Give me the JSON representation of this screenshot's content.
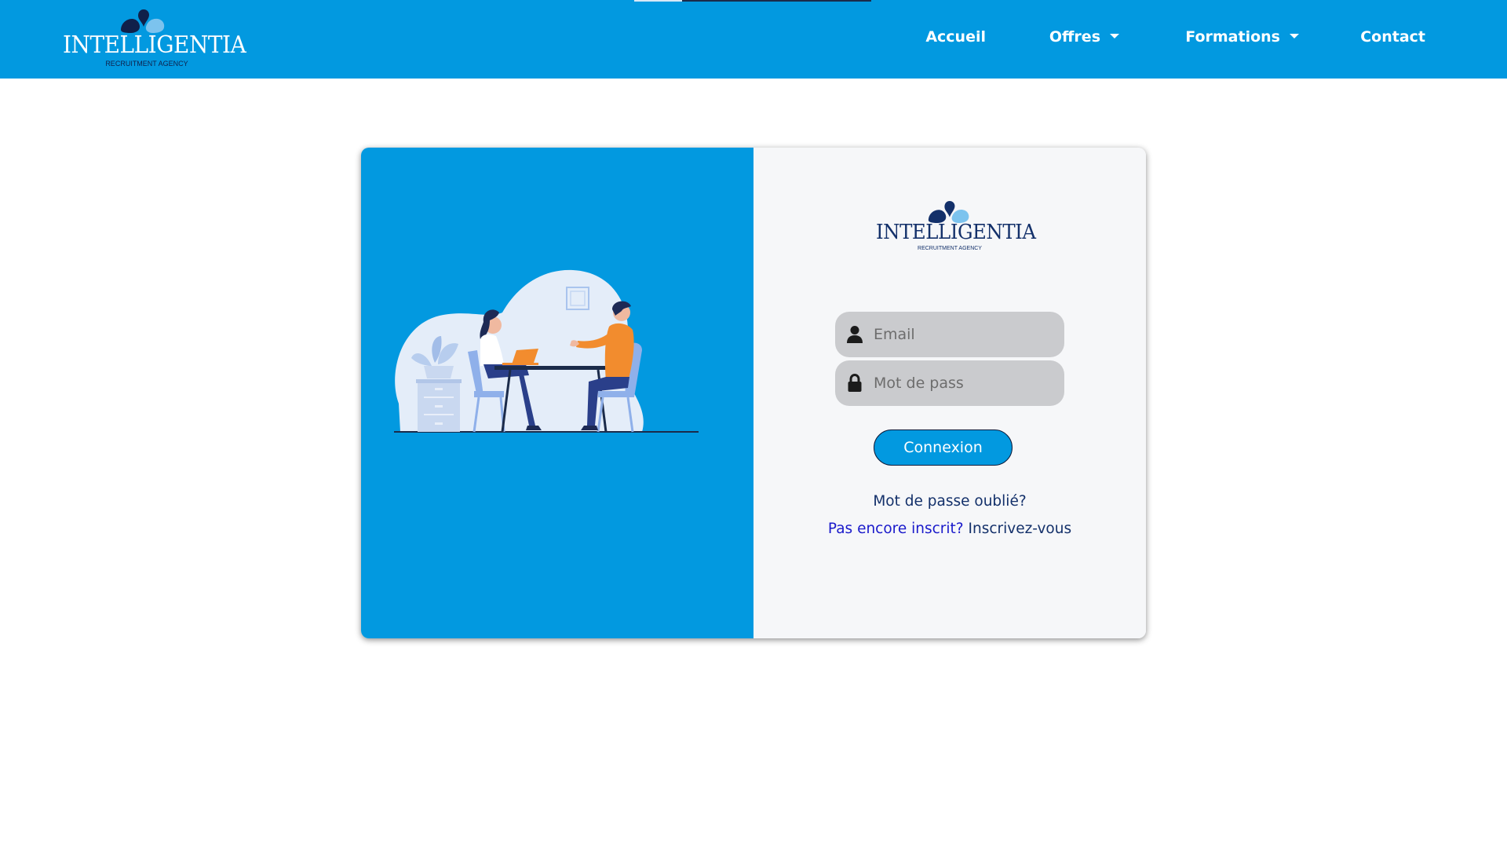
{
  "colors": {
    "primary": "#0299e0",
    "card_background": "#f6f7f9",
    "input_background": "#cacbce",
    "dark_navy": "#13306a",
    "link_blue": "#1a1acb"
  },
  "navbar": {
    "brand": {
      "name": "INTELLIGENTIA",
      "tagline": "RECRUITMENT AGENCY"
    },
    "links": [
      {
        "label": "Accueil",
        "has_dropdown": false
      },
      {
        "label": "Offres",
        "has_dropdown": true
      },
      {
        "label": "Formations",
        "has_dropdown": true
      },
      {
        "label": "Contact",
        "has_dropdown": false
      }
    ]
  },
  "login": {
    "illustration": "two-people-interview-icon",
    "logo": {
      "name": "INTELLIGENTIA",
      "tagline": "RECRUITMENT AGENCY"
    },
    "email": {
      "placeholder": "Email",
      "value": "",
      "icon": "user-icon"
    },
    "password": {
      "placeholder": "Mot de pass",
      "value": "",
      "icon": "lock-icon"
    },
    "submit_label": "Connexion",
    "forgot_password": "Mot de passe oublié?",
    "register_prompt": "Pas encore inscrit?",
    "register_link": "Inscrivez-vous"
  }
}
